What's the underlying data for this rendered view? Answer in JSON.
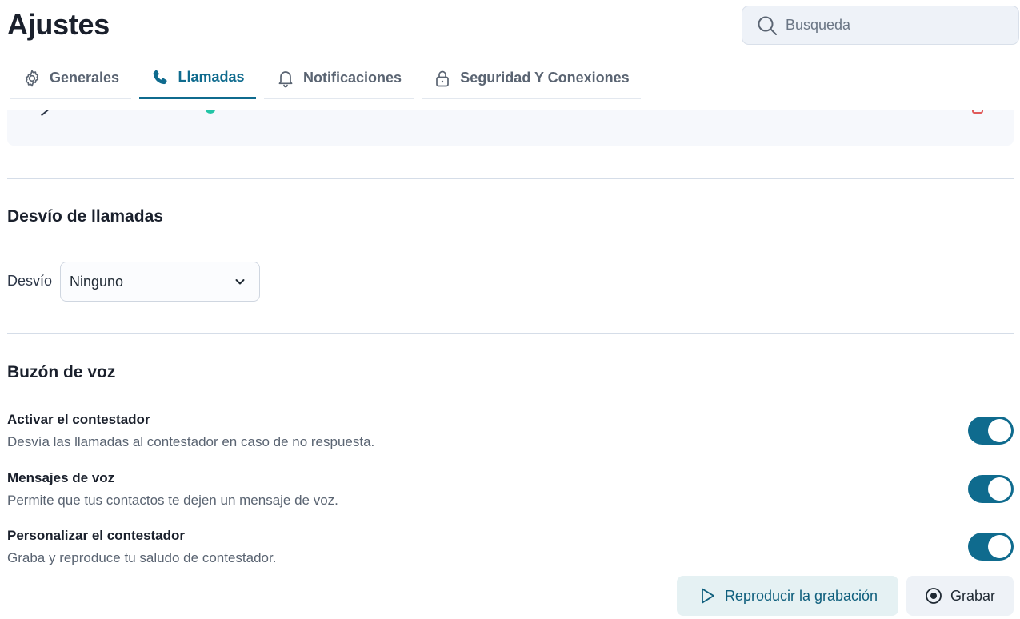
{
  "header": {
    "title": "Ajustes",
    "search": {
      "placeholder": "Busqueda",
      "icon": "search-icon"
    }
  },
  "tabs": [
    {
      "label": "Generales",
      "icon": "gear-icon",
      "active": false
    },
    {
      "label": "Llamadas",
      "icon": "phone-icon",
      "active": true
    },
    {
      "label": "Notificaciones",
      "icon": "bell-icon",
      "active": false
    },
    {
      "label": "Seguridad Y Conexiones",
      "icon": "lock-icon",
      "active": false
    }
  ],
  "forwarding": {
    "title": "Desvío de llamadas",
    "label": "Desvío",
    "selected": "Ninguno"
  },
  "voicemail": {
    "title": "Buzón de voz",
    "settings": [
      {
        "title": "Activar el contestador",
        "description": "Desvía las llamadas al contestador en caso de no respuesta.",
        "enabled": true
      },
      {
        "title": "Mensajes de voz",
        "description": "Permite que tus contactos te dejen un mensaje de voz.",
        "enabled": true
      },
      {
        "title": "Personalizar el contestador",
        "description": "Graba y reproduce tu saludo de contestador.",
        "enabled": true
      }
    ],
    "play_label": "Reproducir la grabación",
    "record_label": "Grabar"
  },
  "colors": {
    "accent": "#0f6b8e",
    "toggle_on": "#0f6b8e",
    "search_bg": "#eef2f8"
  }
}
